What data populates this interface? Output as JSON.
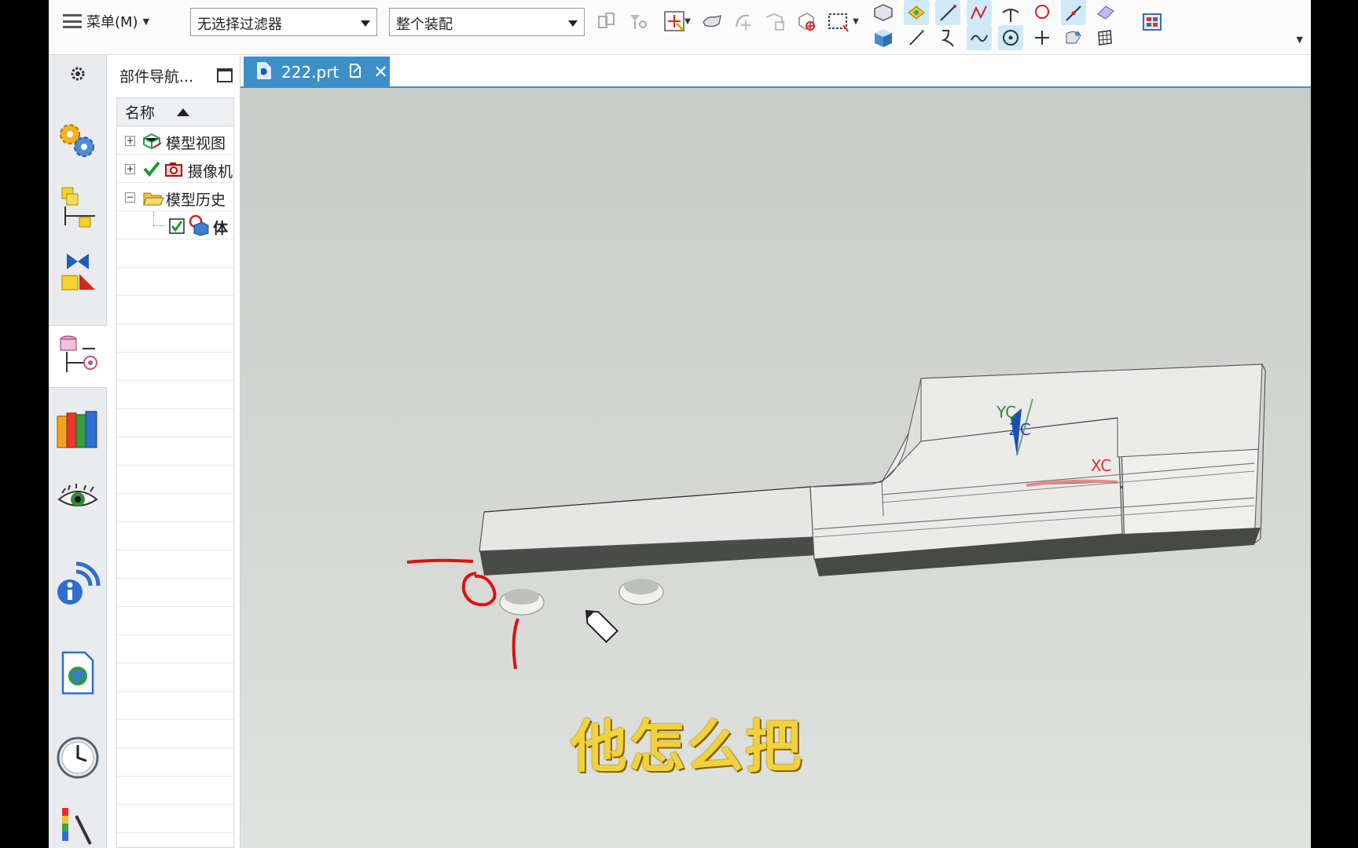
{
  "toolbar": {
    "menu_label": "菜单(M)",
    "filter_value": "无选择过滤器",
    "assembly_value": "整个装配",
    "colors": {
      "highlight": "#cfe9f7",
      "bar": "#fbfbfb"
    }
  },
  "resource_bar": {
    "icons": [
      "gear-icon",
      "roles-icon",
      "assembly-navigator-icon",
      "constraint-navigator-icon",
      "part-navigator-icon",
      "reuse-library-icon",
      "visualization-icon",
      "info-icon",
      "web-browser-icon",
      "history-icon",
      "process-studio-icon"
    ],
    "active": "part-navigator-icon"
  },
  "navigator": {
    "title": "部件导航...",
    "column_name": "名称",
    "rows": [
      {
        "label": "模型视图",
        "expander": "+"
      },
      {
        "label": "摄像机",
        "expander": "+"
      },
      {
        "label": "模型历史",
        "expander": "−"
      },
      {
        "label": "体"
      }
    ]
  },
  "tab": {
    "filename": "222.prt",
    "color": "#3d8fc8"
  },
  "viewport": {
    "axes": {
      "y": "YC",
      "z": "ZC",
      "x": "XC"
    },
    "annotation_color": "#e01010"
  },
  "subtitle": "他怎么把"
}
